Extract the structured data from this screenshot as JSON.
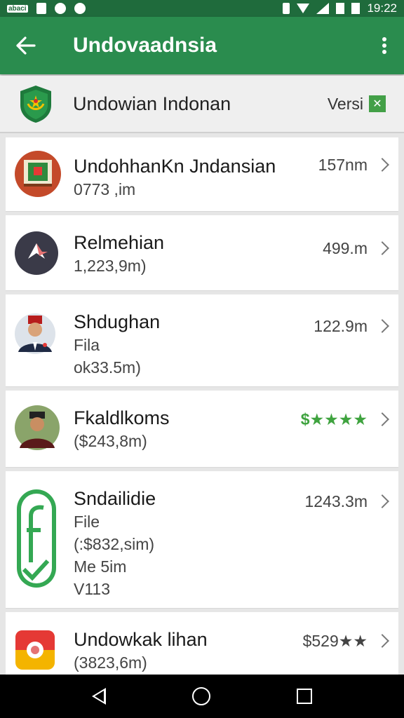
{
  "status_bar": {
    "left_label": "abaci",
    "time": "19:22"
  },
  "app_bar": {
    "title": "Undovaadnsia"
  },
  "header": {
    "title": "Undowian Indonan",
    "version_label": "Versi",
    "version_badge": "✕"
  },
  "colors": {
    "app_bar": "#2a8c4e",
    "status_bar": "#1f6b3c",
    "rating_green": "#3fa33f"
  },
  "items": [
    {
      "name": "UndohhanKn Jndansian",
      "lines": [
        "0773 ,im"
      ],
      "size": "157nm",
      "icon": "flag-badge-icon"
    },
    {
      "name": "Relmehian",
      "lines": [
        "1,223,9m)"
      ],
      "size": "499.m",
      "icon": "star-avatar-icon"
    },
    {
      "name": "Shdughan",
      "lines": [
        "Fila",
        "ok33.5m)"
      ],
      "size": "122.9m",
      "icon": "person-avatar-icon"
    },
    {
      "name": "Fkaldlkoms",
      "lines": [
        "($243,8m)"
      ],
      "size": "$★★★★",
      "icon": "person-avatar-icon"
    },
    {
      "name": "Sndailidie",
      "lines": [
        "File",
        "(:$832,sim)",
        "Me 5im",
        "V113"
      ],
      "size": "1243.3m",
      "icon": "green-f-app-icon"
    },
    {
      "name": "Undowkak lihan",
      "lines": [
        "(3823,6m)"
      ],
      "size": "$529★★",
      "icon": "gallery-app-icon"
    }
  ]
}
